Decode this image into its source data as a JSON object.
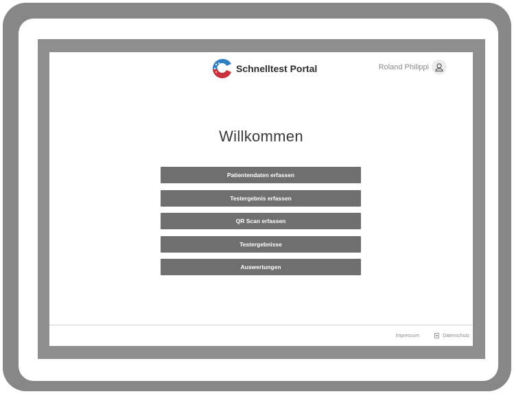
{
  "header": {
    "app_title": "Schnelltest Portal",
    "user_name": "Roland Philippi",
    "logo_icon": "schnelltest-logo-icon",
    "avatar_icon": "user-icon"
  },
  "main": {
    "title": "Willkommen",
    "menu": [
      {
        "label": "Patientendaten erfassen"
      },
      {
        "label": "Testergebnis erfassen"
      },
      {
        "label": "QR Scan erfassen"
      },
      {
        "label": "Testergebnisse"
      },
      {
        "label": "Auswertungen"
      }
    ]
  },
  "footer": {
    "impressum": "Impressum",
    "datenschutz": "Datenschutz",
    "datenschutz_icon": "document-icon"
  },
  "colors": {
    "button_bg": "#6f6f6f",
    "button_text": "#ffffff",
    "logo_blue": "#2f7fc4",
    "logo_red": "#c8323c",
    "frame": "#878787"
  }
}
